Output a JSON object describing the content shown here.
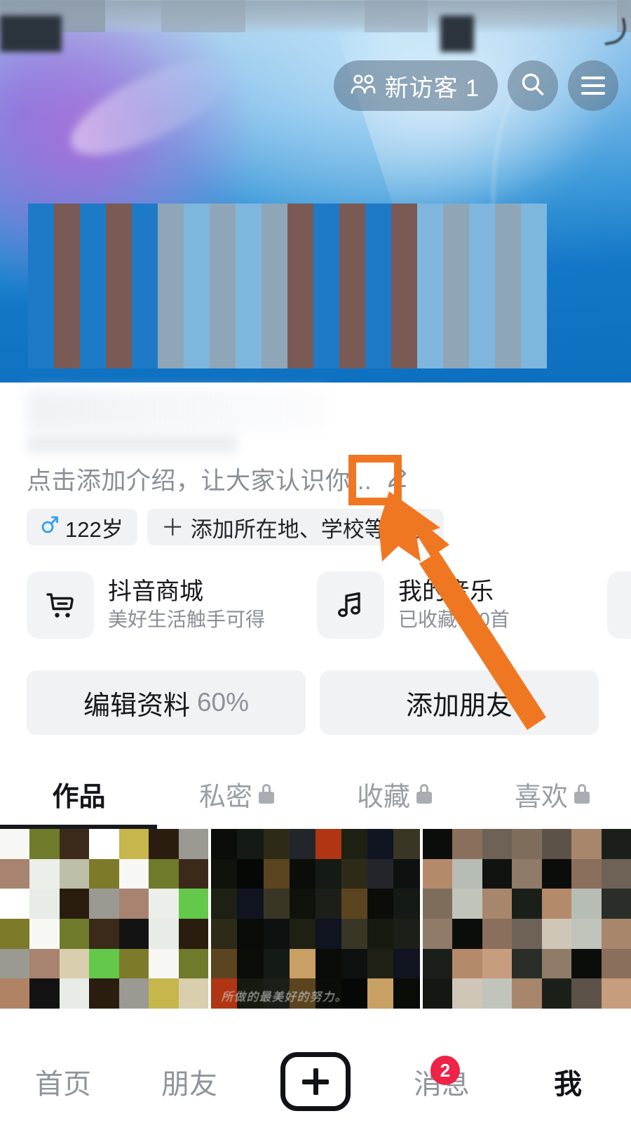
{
  "header": {
    "visitor_pill": {
      "icon": "visitors-icon",
      "label": "新访客 1"
    },
    "search_icon": "search-icon",
    "menu_icon": "hamburger-menu-icon"
  },
  "profile": {
    "bio_placeholder": "点击添加介绍，让大家认识你...",
    "edit_bio_icon": "pencil-edit-icon",
    "tags": [
      {
        "icon": "male-gender-icon",
        "label": "122岁"
      },
      {
        "icon": "plus-icon",
        "label": "添加所在地、学校等标签"
      }
    ]
  },
  "shortcut_cards": [
    {
      "icon": "shopping-cart-icon",
      "title": "抖音商城",
      "subtitle": "美好生活触手可得"
    },
    {
      "icon": "music-note-icon",
      "title": "我的音乐",
      "subtitle": "已收藏330首"
    }
  ],
  "actions": [
    {
      "label": "编辑资料",
      "value": "60%"
    },
    {
      "label": "添加朋友",
      "value": ""
    }
  ],
  "content_tabs": [
    {
      "label": "作品",
      "locked": false,
      "active": true
    },
    {
      "label": "私密",
      "locked": true,
      "active": false
    },
    {
      "label": "收藏",
      "locked": true,
      "active": false
    },
    {
      "label": "喜欢",
      "locked": true,
      "active": false
    }
  ],
  "video_grid": [
    {
      "caption": ""
    },
    {
      "caption": "所做的最美好的努力。"
    },
    {
      "caption": ""
    }
  ],
  "bottom_nav": [
    {
      "label": "首页",
      "badge": "",
      "active": false
    },
    {
      "label": "朋友",
      "badge": "",
      "active": false
    },
    {
      "label": "",
      "badge": "",
      "active": false,
      "icon": "create-post-plus-icon"
    },
    {
      "label": "消息",
      "badge": "2",
      "active": false
    },
    {
      "label": "我",
      "badge": "",
      "active": true
    }
  ],
  "annotation": {
    "highlight_color": "#f07722",
    "target": "pencil-edit-icon",
    "arrow": "orange-pointer-arrow"
  },
  "colors": {
    "banner_blue": "#0c6fc0",
    "accent_orange": "#f07722",
    "badge_red": "#ee2347",
    "card_gray": "#f1f2f4",
    "muted_text": "#8b8f96",
    "dark_text": "#15161a"
  }
}
